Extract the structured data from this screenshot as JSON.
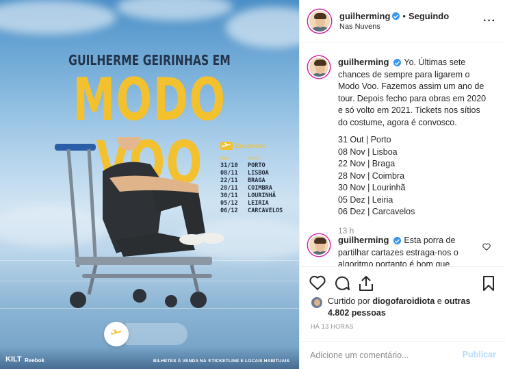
{
  "poster": {
    "subtitle": "GUILHERME GEIRINHAS EM",
    "title": "MODO VOO",
    "departures_title": "Departures",
    "col_date": "Data",
    "col_dest": "Destino",
    "rows": [
      {
        "date": "31/10",
        "city": "PORTO"
      },
      {
        "date": "08/11",
        "city": "LISBOA"
      },
      {
        "date": "22/11",
        "city": "BRAGA"
      },
      {
        "date": "28/11",
        "city": "COIMBRA"
      },
      {
        "date": "30/11",
        "city": "LOURINHÃ"
      },
      {
        "date": "05/12",
        "city": "LEIRIA"
      },
      {
        "date": "06/12",
        "city": "CARCAVELOS"
      }
    ],
    "kilt": "KILT",
    "reebok_line1": "Reebok",
    "tickets": "BILHETES À VENDA NA ↯TICKETLINE E LOCAIS HABITUAIS",
    "accent_color": "#f3c12d"
  },
  "header": {
    "username": "guilherming",
    "separator": "•",
    "follow_status": "Seguindo",
    "location": "Nas Nuvens",
    "more_label": "···"
  },
  "caption": {
    "username": "guilherming",
    "text": "Yo. Últimas sete chances de sempre para ligarem o Modo Voo. Fazemos assim um ano de tour. Depois fecho para obras em 2020 e só volto em 2021. Tickets nos sítios do costume, agora é convosco.",
    "dates": [
      "31 Out | Porto",
      "08 Nov | Lisboa",
      "22 Nov | Braga",
      "28 Nov | Coimbra",
      "30 Nov | Lourinhã",
      "05 Dez | Leiria",
      "06 Dez | Carcavelos"
    ],
    "time": "13 h"
  },
  "comment2": {
    "username": "guilherming",
    "text": "Esta porra de partilhar cartazes estraga-nos o algoritmo portanto é bom que"
  },
  "likes": {
    "prefix": "Curtido por ",
    "user": "diogofaroidiota",
    "middle": " e",
    "others": "outras 4.802 pessoas"
  },
  "post_age": "HÁ 13 HORAS",
  "comment_box": {
    "placeholder": "Adicione um comentário...",
    "publish": "Publicar"
  },
  "icons": {
    "like": "heart-icon",
    "comment": "comment-icon",
    "share": "share-icon",
    "save": "bookmark-icon"
  },
  "colors": {
    "verified": "#3897f0",
    "publish_disabled": "#b3dbff",
    "muted": "#8e8e8e"
  }
}
